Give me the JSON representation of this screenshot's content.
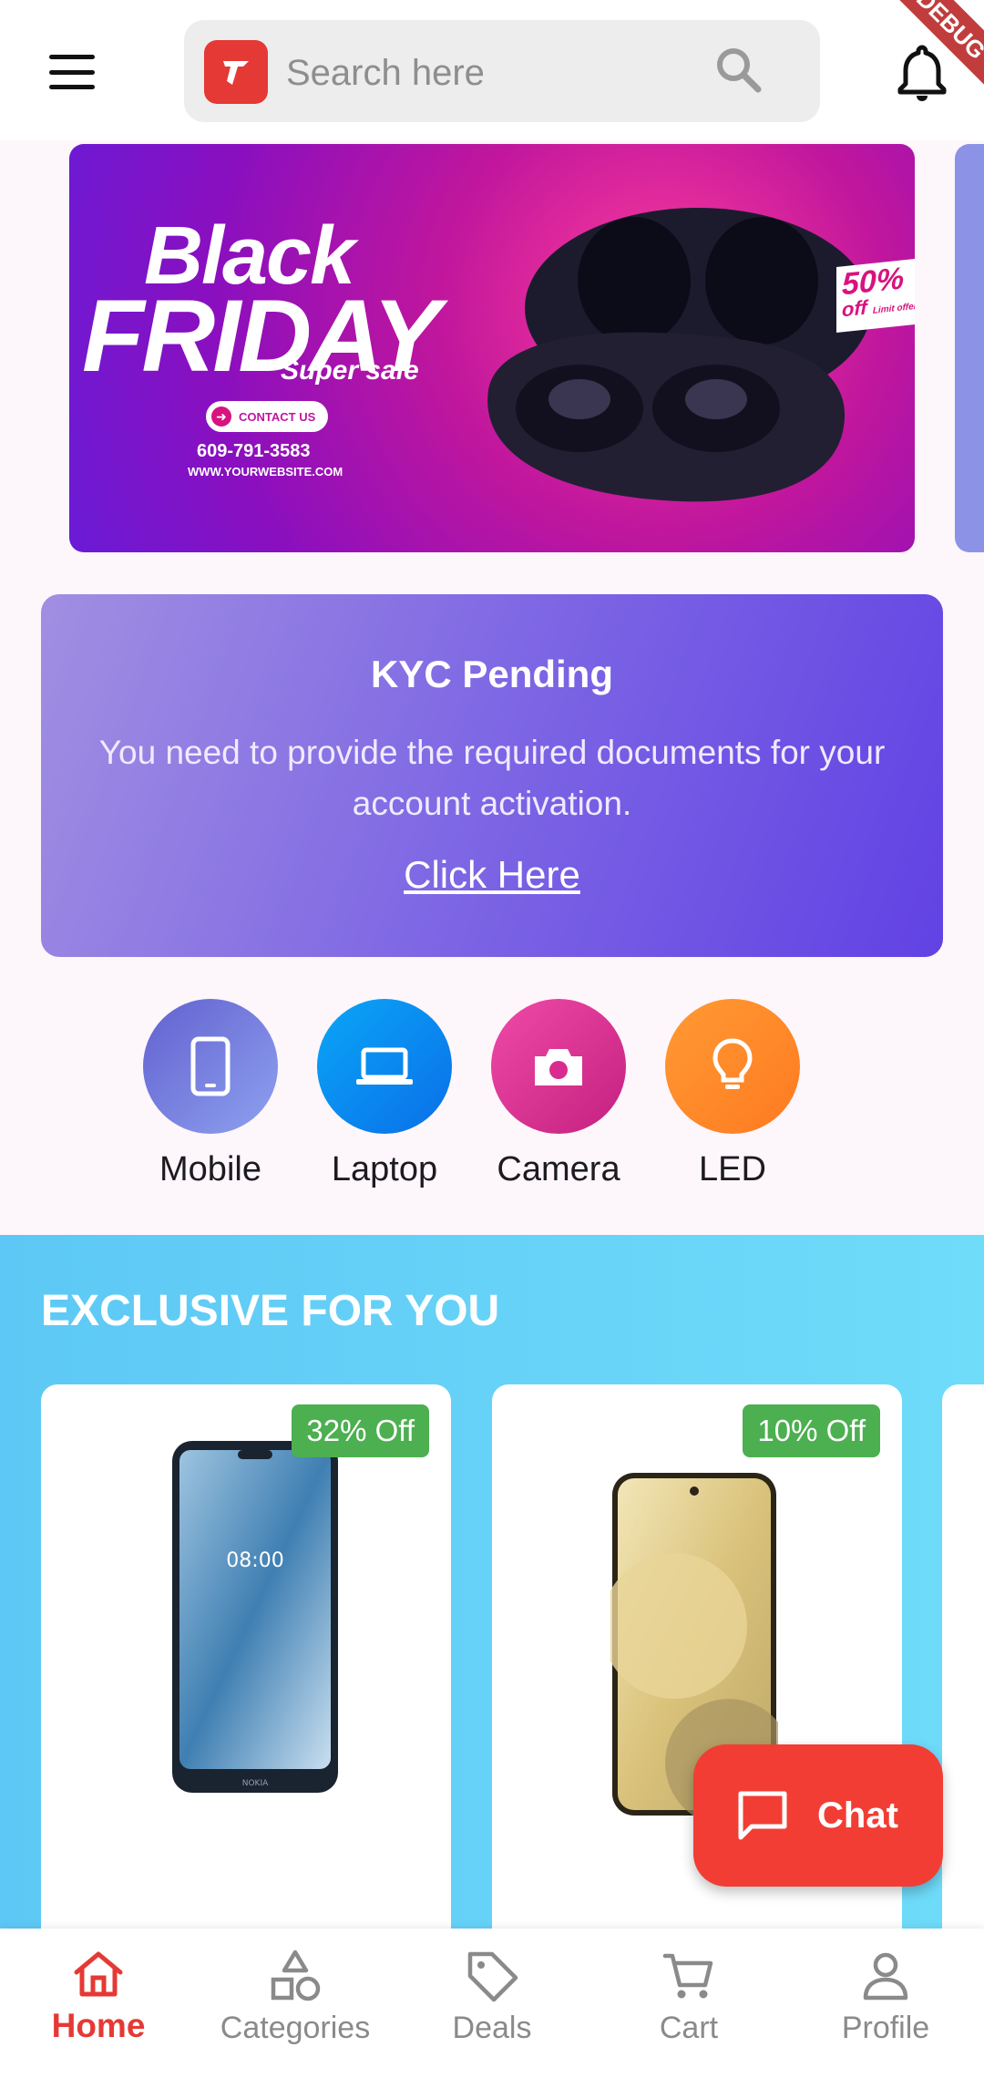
{
  "header": {
    "search_placeholder": "Search here",
    "debug_label": "DEBUG"
  },
  "banner": {
    "line1": "Black",
    "line2": "FRIDAY",
    "subtitle": "Super sale",
    "contact_label": "CONTACT US",
    "phone": "609-791-3583",
    "website": "WWW.YOURWEBSITE.COM",
    "discount": "50%",
    "discount_off": "off",
    "discount_note": "Limit offer"
  },
  "kyc": {
    "title": "KYC Pending",
    "message": "You need to provide the required documents for your account activation.",
    "link": "Click Here"
  },
  "categories": [
    {
      "label": "Mobile",
      "icon": "phone-icon",
      "color": "#6e6fd8"
    },
    {
      "label": "Laptop",
      "icon": "laptop-icon",
      "color": "#0b8ff0"
    },
    {
      "label": "Camera",
      "icon": "camera-icon",
      "color": "#e0359a"
    },
    {
      "label": "LED",
      "icon": "bulb-icon",
      "color": "#ff8a2b"
    }
  ],
  "exclusive": {
    "title": "EXCLUSIVE FOR YOU",
    "products": [
      {
        "badge": "32% Off",
        "screen_time": "08:00",
        "brand": "NOKIA"
      },
      {
        "badge": "10% Off"
      }
    ]
  },
  "chat": {
    "label": "Chat"
  },
  "nav": {
    "items": [
      {
        "label": "Home",
        "icon": "home-icon",
        "active": true
      },
      {
        "label": "Categories",
        "icon": "categories-icon",
        "active": false
      },
      {
        "label": "Deals",
        "icon": "tag-icon",
        "active": false
      },
      {
        "label": "Cart",
        "icon": "cart-icon",
        "active": false
      },
      {
        "label": "Profile",
        "icon": "person-icon",
        "active": false
      }
    ]
  },
  "colors": {
    "accent": "#e53935",
    "kyc_gradient_start": "#a08fe2",
    "kyc_gradient_end": "#6142e4",
    "discount_badge": "#4caf50",
    "exclusive_bg": "#5dc8f5"
  }
}
